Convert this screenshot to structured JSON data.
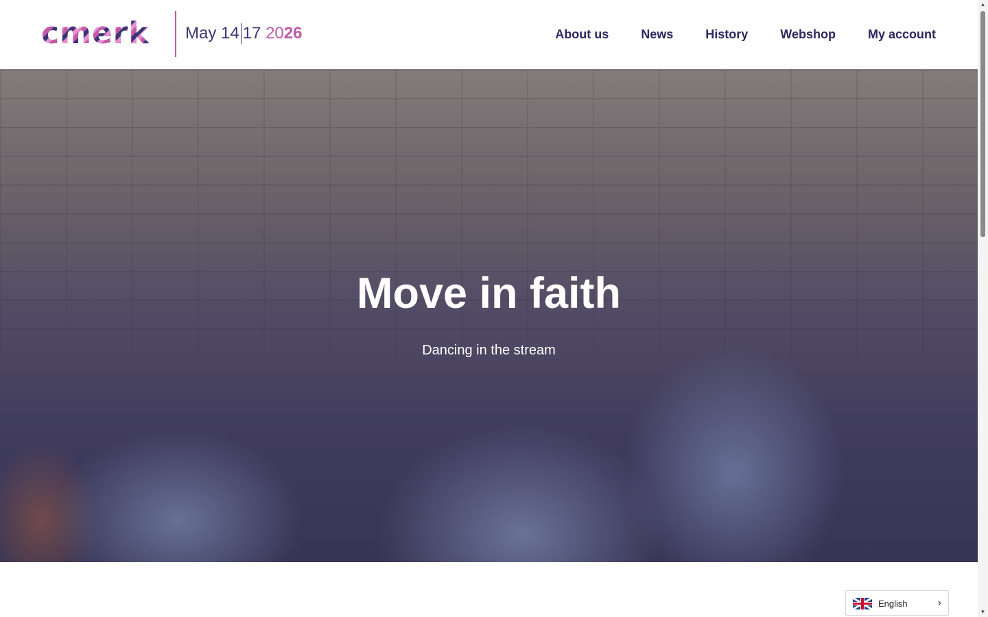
{
  "header": {
    "logo": {
      "wordmark": "cmerk",
      "date_month_day": "May 14",
      "date_end_day": "17",
      "year_light": "20",
      "year_bold": "26"
    },
    "nav": [
      {
        "label": "About us"
      },
      {
        "label": "News"
      },
      {
        "label": "History"
      },
      {
        "label": "Webshop"
      },
      {
        "label": "My account"
      }
    ]
  },
  "hero": {
    "title": "Move in faith",
    "subtitle": "Dancing in the stream"
  },
  "language_switcher": {
    "label": "English",
    "flag_icon": "uk-flag-icon"
  },
  "colors": {
    "nav_text": "#2c2860",
    "accent_pink": "#c25aa6",
    "accent_purple": "#3b3476"
  }
}
